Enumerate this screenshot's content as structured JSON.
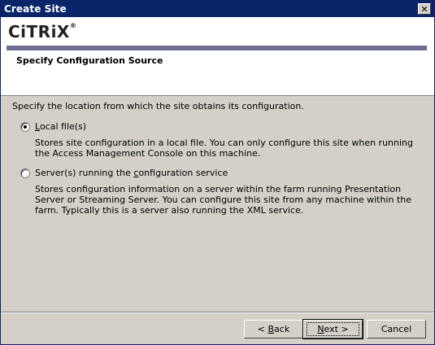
{
  "window": {
    "title": "Create Site",
    "close_glyph": "✕"
  },
  "header": {
    "logo_text": "CiTRiX",
    "logo_mark": "®",
    "page_title": "Specify Configuration Source"
  },
  "content": {
    "prompt": "Specify the location from which the site obtains its configuration.",
    "options": [
      {
        "label_pre": "",
        "label_accel": "L",
        "label_post": "ocal file(s)",
        "selected": true,
        "description": "Stores site configuration in a local file. You can only configure this site when running the Access Management Console on this machine."
      },
      {
        "label_pre": "Server(s) running the ",
        "label_accel": "c",
        "label_post": "onfiguration service",
        "selected": false,
        "description": "Stores configuration information on a server within the farm running Presentation Server or Streaming Server.  You can configure this site from any machine within the farm.  Typically this is a server also running the XML service."
      }
    ]
  },
  "buttons": {
    "back_pre": "< ",
    "back_accel": "B",
    "back_post": "ack",
    "next_accel": "N",
    "next_post": "ext >",
    "cancel": "Cancel"
  }
}
